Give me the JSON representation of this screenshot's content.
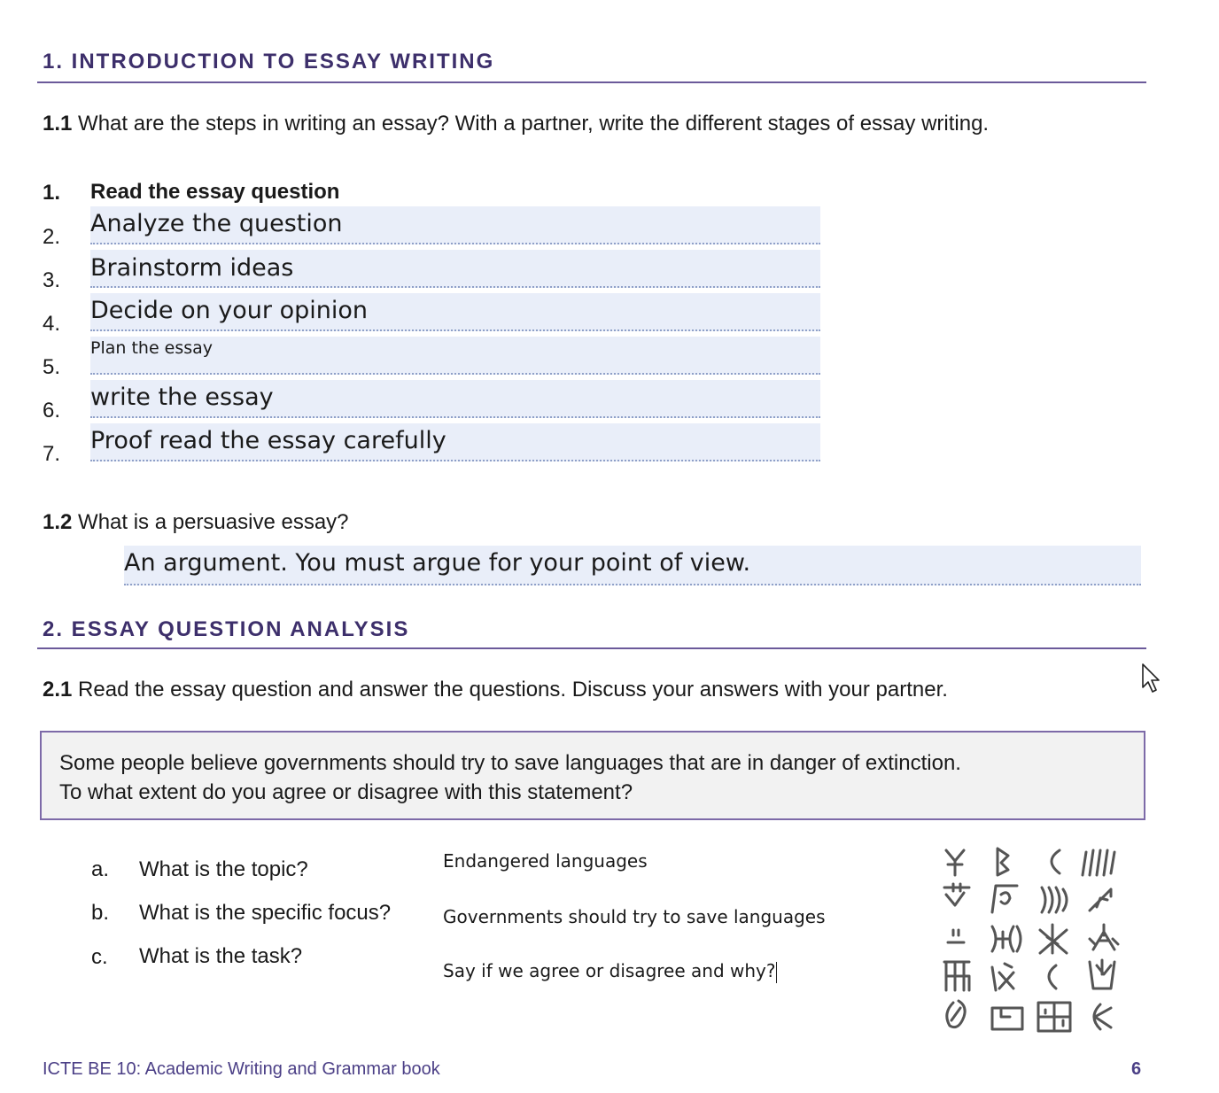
{
  "section1": {
    "heading": "1. INTRODUCTION TO ESSAY WRITING",
    "q1_1": {
      "number": "1.1",
      "text": " What are the steps in writing an essay?  With a partner, write the different stages of essay writing."
    },
    "steps": [
      {
        "num": "1.",
        "text": "Read the essay question"
      },
      {
        "num": "2.",
        "text": "Analyze the question"
      },
      {
        "num": "3.",
        "text": "Brainstorm ideas"
      },
      {
        "num": "4.",
        "text": "Decide on your opinion"
      },
      {
        "num": "5.",
        "text": "Plan the essay"
      },
      {
        "num": "6.",
        "text": "write the essay"
      },
      {
        "num": "7.",
        "text": "Proof read the essay carefully"
      }
    ],
    "q1_2": {
      "number": "1.2",
      "text": " What is a persuasive essay?",
      "answer": "An argument.  You must argue for your point of view."
    }
  },
  "section2": {
    "heading": "2. ESSAY QUESTION ANALYSIS",
    "q2_1": {
      "number": "2.1",
      "text": " Read the essay question and answer the questions.  Discuss your answers with your partner."
    },
    "statement": [
      "Some people believe governments should try to save languages that are in danger of extinction.",
      "To what extent do you agree or disagree with this statement?"
    ],
    "sub_questions": [
      {
        "letter": "a.",
        "question": "What is the topic?",
        "answer": "Endangered languages"
      },
      {
        "letter": "b.",
        "question": "What is the specific focus?",
        "answer": "Governments should try to save languages"
      },
      {
        "letter": "c.",
        "question": "What is the task?",
        "answer": "Say if we agree or disagree and why?"
      }
    ]
  },
  "footer": {
    "title": "ICTE BE 10: Academic Writing and Grammar book",
    "page": "6"
  },
  "icons": {
    "glyphs": "ancient-script-glyphs-icon",
    "cursor": "mouse-pointer-icon"
  },
  "colors": {
    "heading": "#3d2f6b",
    "rule": "#6b5a9a",
    "field_bg": "#e9eef9",
    "box_border": "#7d6aa8"
  }
}
